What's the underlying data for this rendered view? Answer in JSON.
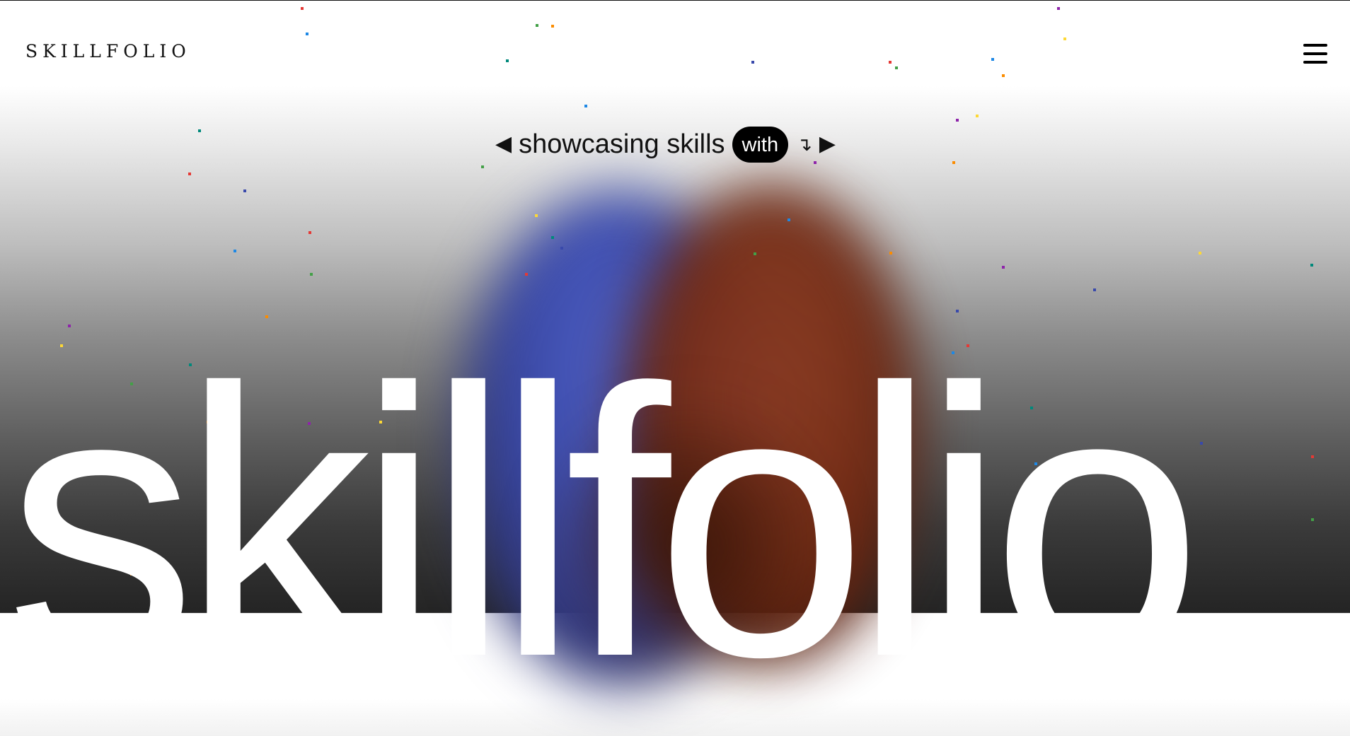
{
  "header": {
    "logo_text": "SKILLFOLIO",
    "menu_icon": "hamburger-menu-icon"
  },
  "tagline": {
    "prev_icon": "◀",
    "text": "showcasing skills",
    "pill": "with",
    "hook": "↴",
    "next_icon": "▶"
  },
  "hero": {
    "title": "skillfolio"
  },
  "colors": {
    "blob_blue": "#4e5fc4",
    "blob_red": "#8c3a20",
    "confetti": [
      "#e53935",
      "#1e88e5",
      "#43a047",
      "#fb8c00",
      "#8e24aa",
      "#fdd835",
      "#00897b",
      "#3949ab"
    ]
  }
}
